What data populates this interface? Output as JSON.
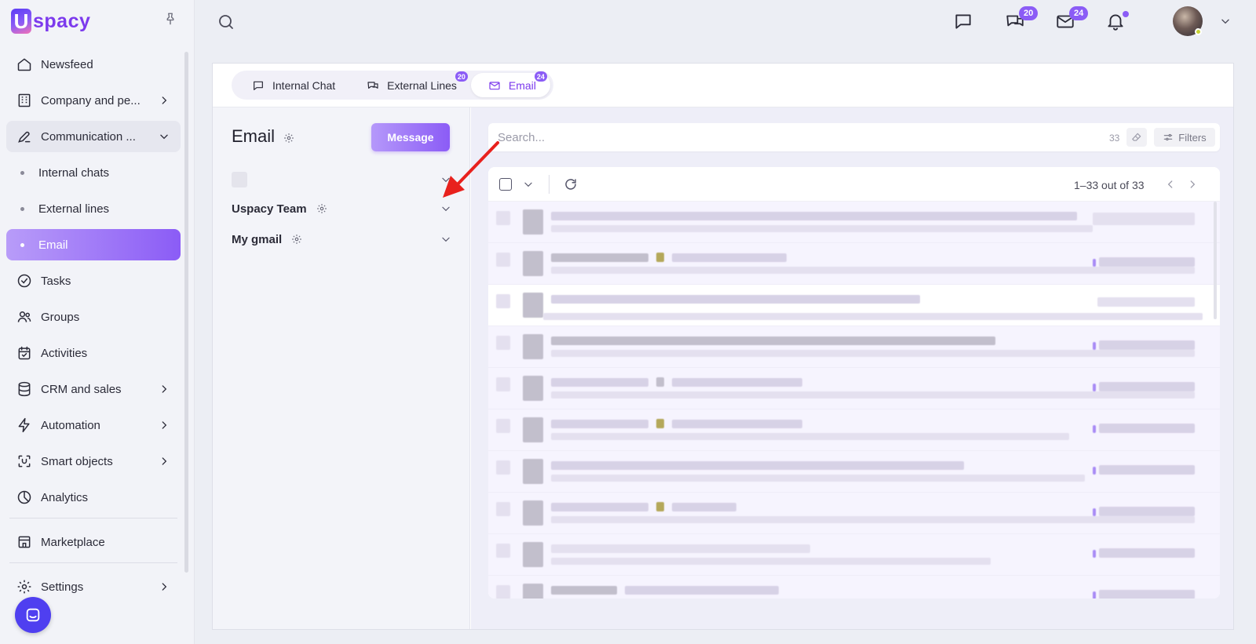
{
  "app": {
    "logo_letter": "U",
    "logo_text": "spacy"
  },
  "sidebar": {
    "items": [
      {
        "label": "Newsfeed",
        "icon": "home-icon"
      },
      {
        "label": "Company and pe...",
        "icon": "building-icon"
      },
      {
        "label": "Communication ...",
        "icon": "communication-icon"
      },
      {
        "label": "Internal chats"
      },
      {
        "label": "External lines"
      },
      {
        "label": "Email"
      },
      {
        "label": "Tasks",
        "icon": "check-circle-icon"
      },
      {
        "label": "Groups",
        "icon": "groups-icon"
      },
      {
        "label": "Activities",
        "icon": "calendar-icon"
      },
      {
        "label": "CRM and sales",
        "icon": "database-icon"
      },
      {
        "label": "Automation",
        "icon": "lightning-icon"
      },
      {
        "label": "Smart objects",
        "icon": "smart-object-icon"
      },
      {
        "label": "Analytics",
        "icon": "pie-chart-icon"
      },
      {
        "label": "Marketplace",
        "icon": "store-icon"
      },
      {
        "label": "Settings",
        "icon": "gear-icon"
      }
    ]
  },
  "topbar": {
    "chat_badge": "20",
    "mail_badge": "24"
  },
  "tabs": [
    {
      "label": "Internal Chat",
      "badge": ""
    },
    {
      "label": "External Lines",
      "badge": "20"
    },
    {
      "label": "Email",
      "badge": "24"
    }
  ],
  "email_panel": {
    "title": "Email",
    "message_button": "Message",
    "accounts": [
      {
        "label": "Uspacy Team"
      },
      {
        "label": "My gmail"
      }
    ]
  },
  "list": {
    "search_placeholder": "Search...",
    "search_count": "33",
    "filters_label": "Filters",
    "pager_text": "1–33 out of 33"
  },
  "colors": {
    "accent": "#8b5cf6",
    "accent_light": "#b89cf9",
    "annotation_arrow": "#e8211d"
  }
}
